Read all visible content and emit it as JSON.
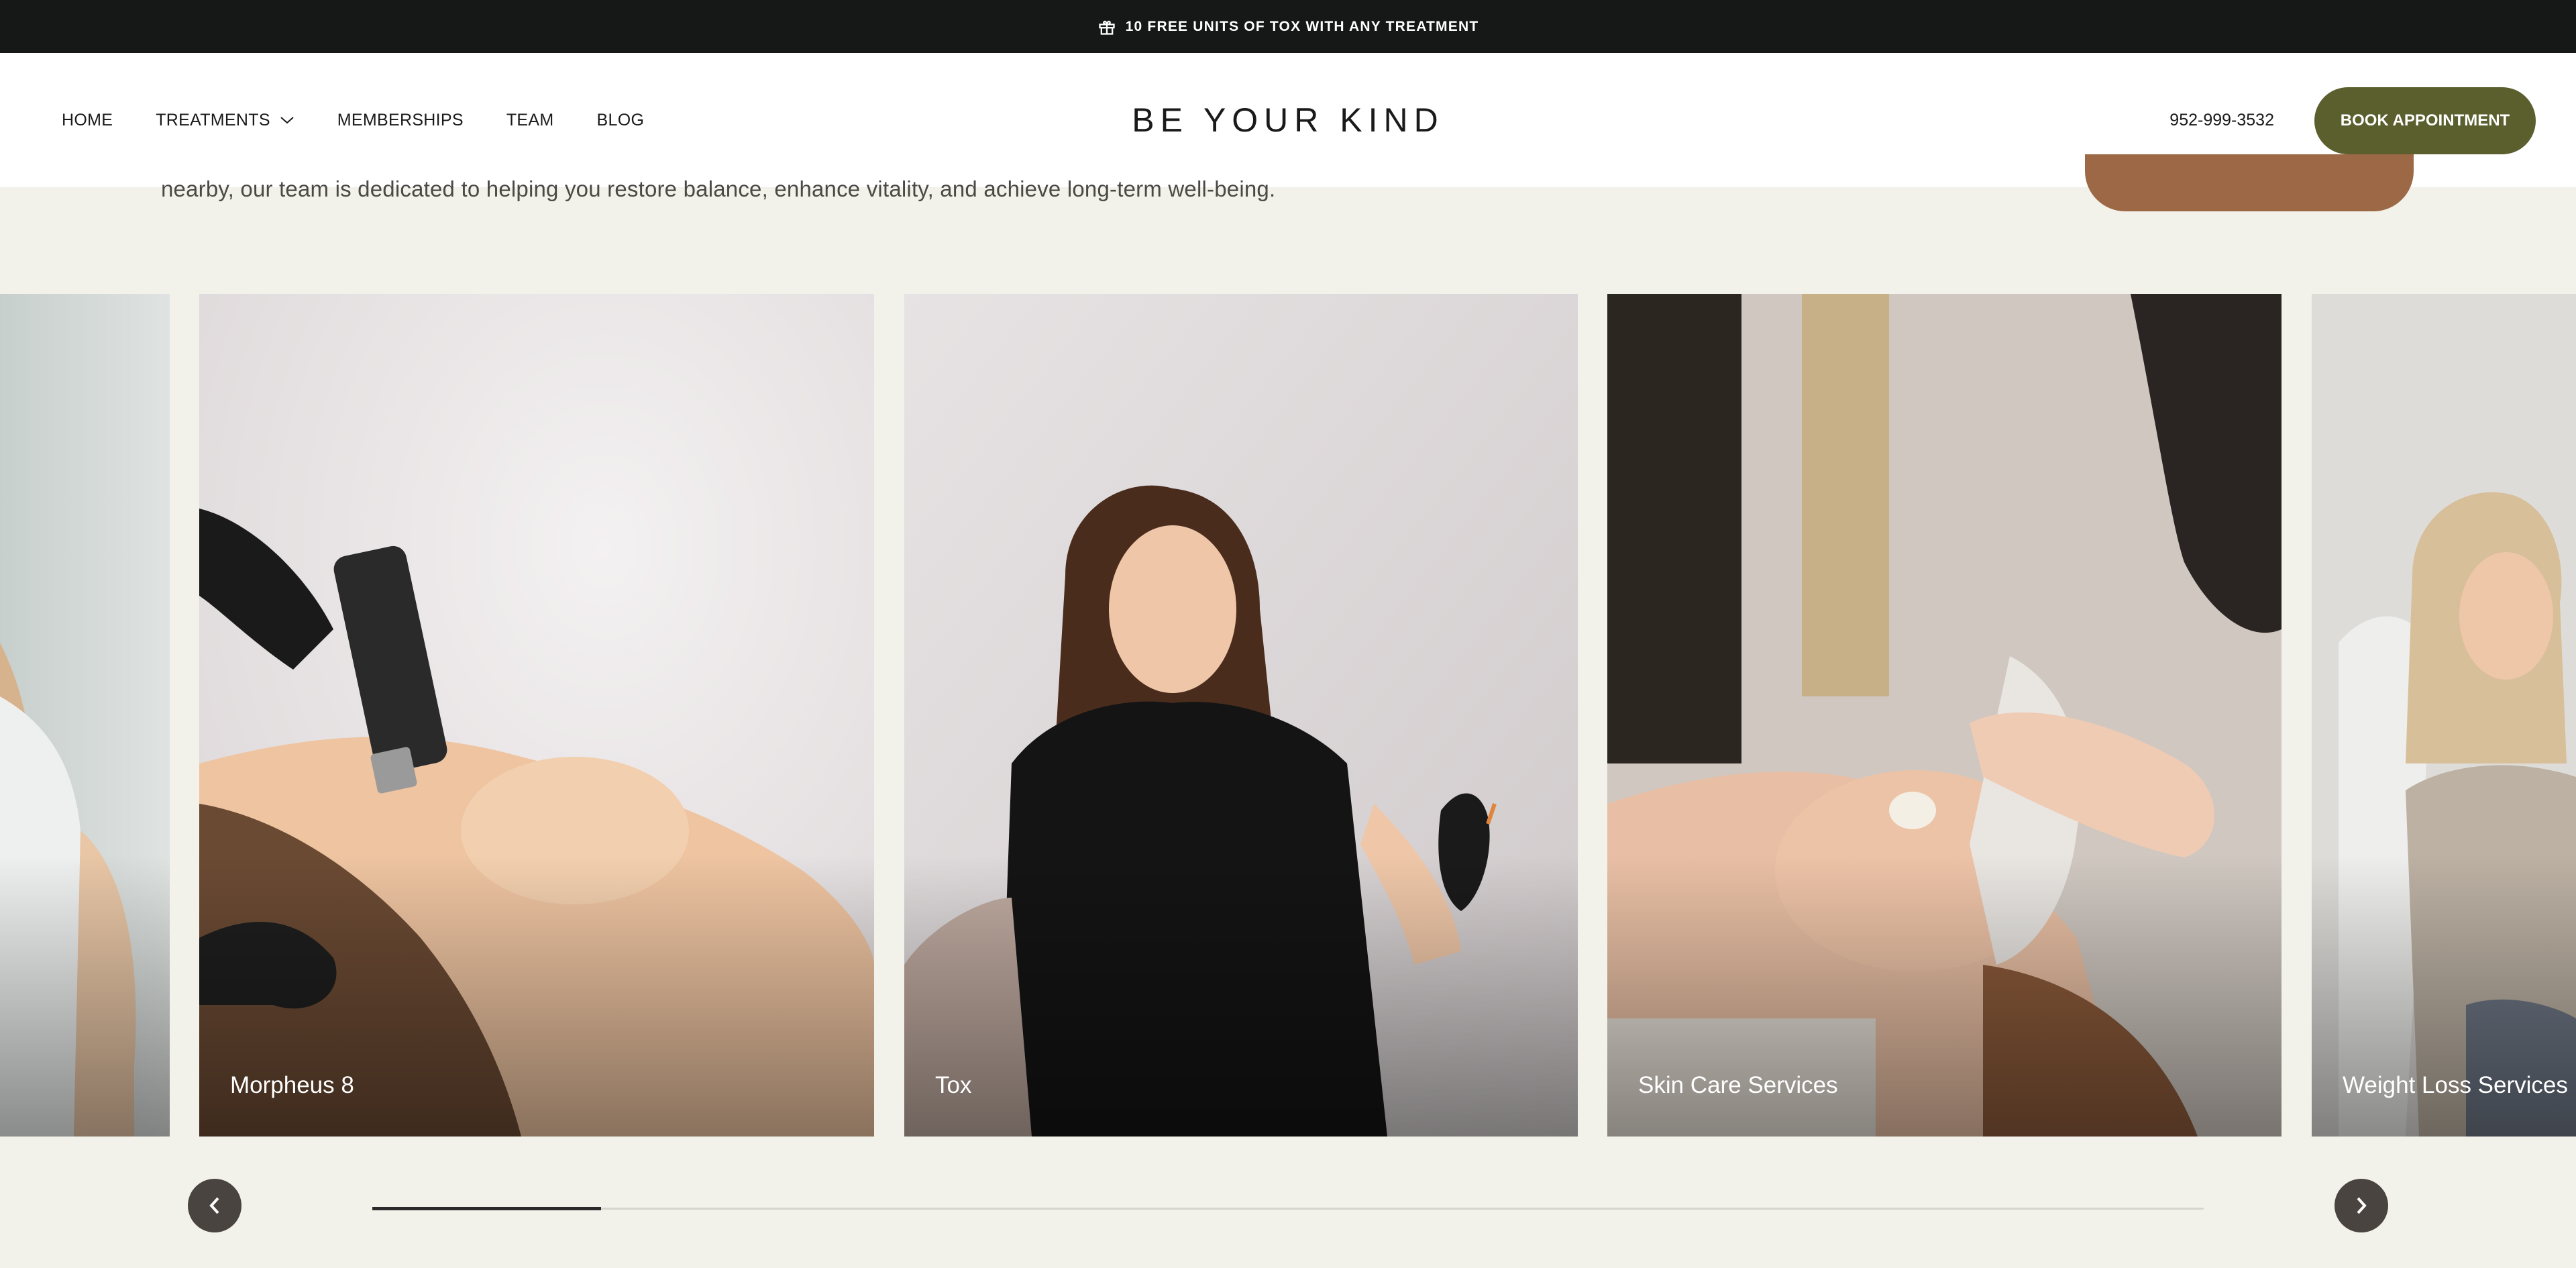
{
  "announcement": {
    "icon": "gift-icon",
    "text": "10 FREE UNITS OF TOX WITH ANY TREATMENT"
  },
  "nav": {
    "items": [
      {
        "label": "HOME"
      },
      {
        "label": "TREATMENTS",
        "has_dropdown": true
      },
      {
        "label": "MEMBERSHIPS"
      },
      {
        "label": "TEAM"
      },
      {
        "label": "BLOG"
      }
    ]
  },
  "brand": {
    "logo_text": "BE YOUR KIND"
  },
  "header": {
    "phone": "952-999-3532",
    "book_label": "BOOK APPOINTMENT"
  },
  "intro": {
    "text": "nearby, our team is dedicated to helping you restore balance, enhance vitality, and achieve long-term well-being."
  },
  "carousel": {
    "cards": [
      {
        "label": ""
      },
      {
        "label": "Morpheus 8"
      },
      {
        "label": "Tox"
      },
      {
        "label": "Skin Care Services"
      },
      {
        "label": "Weight Loss Services"
      }
    ],
    "progress_fraction": 0.125
  },
  "colors": {
    "announcement_bg": "#151816",
    "book_button": "#5b5e2d",
    "page_bg": "#f2f1ea",
    "cta_peek": "#9c6845",
    "carousel_button": "#4a4440"
  }
}
